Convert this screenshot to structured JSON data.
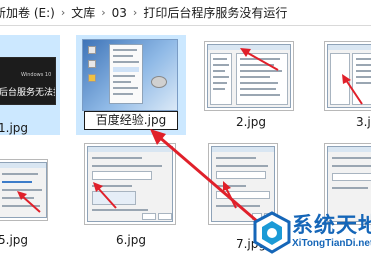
{
  "breadcrumb": {
    "items": [
      "新加卷 (E:)",
      "文库",
      "03",
      "打印后台程序服务没有运行"
    ],
    "separator": "›"
  },
  "files": [
    {
      "name": "1.jpg",
      "thumb_text": [
        "Windows 10",
        "后台服务无法打印"
      ]
    },
    {
      "name": "百度经验.jpg",
      "renaming": true
    },
    {
      "name": "2.jpg"
    },
    {
      "name": "3.jpg"
    },
    {
      "name": "5.jpg"
    },
    {
      "name": "6.jpg"
    },
    {
      "name": "7.jpg"
    }
  ],
  "watermark": {
    "title": "系统天地",
    "url": "XiTongTianDi.net"
  },
  "colors": {
    "selection": "#cce8ff",
    "arrow": "#e0202a",
    "brand": "#1566b8"
  }
}
